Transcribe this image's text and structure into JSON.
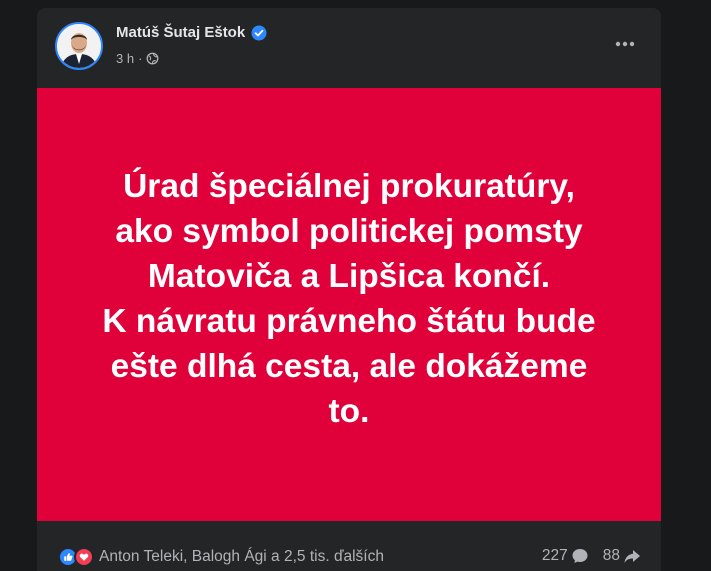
{
  "post": {
    "author": "Matúš Šutaj Eštok",
    "time": "3 h",
    "separator": "·",
    "privacy_icon": "globe-icon",
    "verified_icon": "verified-badge-icon",
    "more_icon": "more-options-icon",
    "text_lines": [
      "Úrad špeciálnej prokuratúry,",
      "ako symbol politickej pomsty",
      "Matoviča a Lipšica končí.",
      "K návratu právneho štátu bude",
      "ešte dlhá cesta, ale dokážeme",
      "to."
    ],
    "background_color": "#e0003a"
  },
  "reactions": {
    "icons": [
      "like-icon",
      "love-icon"
    ],
    "summary": "Anton Teleki, Balogh Ági a 2,5 tis. ďalších"
  },
  "stats": {
    "comments": "227",
    "shares": "88"
  },
  "colors": {
    "page_bg": "#18191a",
    "card_bg": "#242526",
    "accent": "#2d88ff",
    "love": "#f33e58"
  }
}
